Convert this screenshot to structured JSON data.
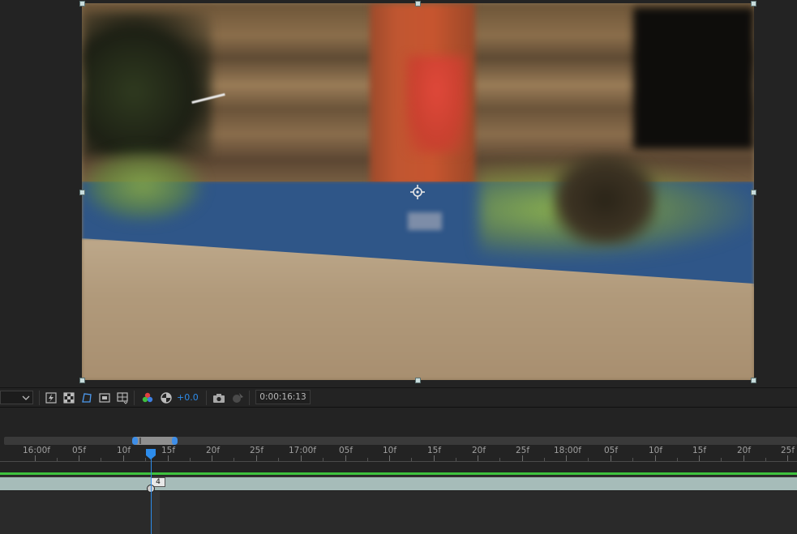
{
  "viewer": {
    "exposure": "+0.0",
    "timecode": "0:00:16:13",
    "toolbar_icons": [
      "fast-previews-icon",
      "transparency-grid-icon",
      "mask-path-icon",
      "region-of-interest-icon",
      "title-action-safe-icon",
      "color-channel-icon",
      "reset-exposure-icon",
      "snapshot-icon",
      "show-snapshot-icon"
    ]
  },
  "timeline": {
    "ruler_labels": [
      "16:00f",
      "05f",
      "10f",
      "15f",
      "20f",
      "25f",
      "17:00f",
      "05f",
      "10f",
      "15f",
      "20f",
      "25f",
      "18:00f",
      "05f",
      "10f",
      "15f",
      "20f",
      "25f"
    ],
    "keyframe_label": "4"
  },
  "colors": {
    "accent": "#2d8ceb",
    "panel_bg": "#232323",
    "layer_clip": "#a6bcb9",
    "audio_bar": "#3ec23e"
  }
}
